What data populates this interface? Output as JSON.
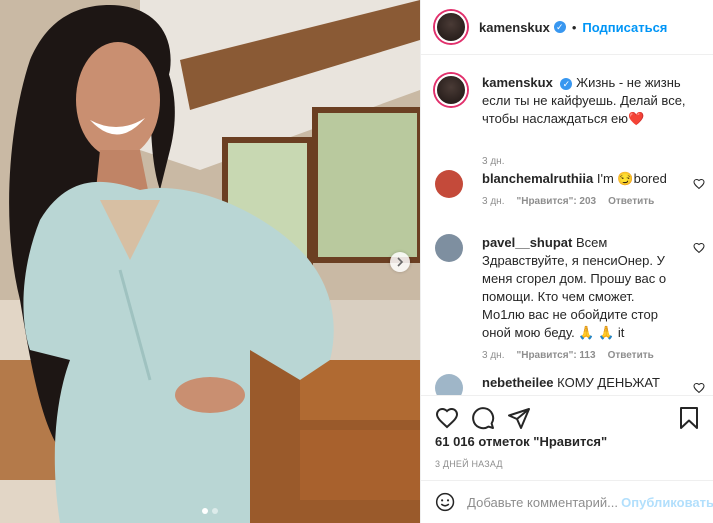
{
  "post": {
    "username": "kamenskux",
    "follow_label": "Подписаться",
    "separator": "•",
    "verified_mark": "✓",
    "caption_user": "kamenskux",
    "caption_text": "Жизнь - не жизнь если ты не кайфуешь. Делай все, чтобы наслаждаться ею",
    "caption_emoji": "❤️",
    "caption_time": "3 дн."
  },
  "comments": [
    {
      "user": "blanchemalruthiia",
      "text": "I'm 😏bored",
      "time": "3 дн.",
      "likes": "\"Нравится\": 203",
      "reply": "Ответить"
    },
    {
      "user": "pavel__shupat",
      "text": "Всем Здравствуйте, я пенсиОнер. У меня сгорел дом. Прошу вас о помощи. Кто чем сможет. Мо1лю вас не обойдите стор оной мою беду. 🙏 🙏 it",
      "time": "3 дн.",
      "likes": "\"Нравится\": 113",
      "reply": "Ответить"
    },
    {
      "user": "nebetheilee",
      "text": "КОМУ ДЕНЬЖАТ"
    }
  ],
  "footer": {
    "likes_text": "61 016 отметок \"Нравится\"",
    "date_text": "3 ДНЕЙ НАЗАД",
    "comment_placeholder": "Добавьте комментарий...",
    "publish_label": "Опубликовать"
  },
  "icons": {
    "like": "heart-icon",
    "comment": "comment-icon",
    "share": "paper-plane-icon",
    "save": "bookmark-icon",
    "emoji": "smiley-icon",
    "next": "chevron-right-icon"
  },
  "colors": {
    "accent": "#0095f6",
    "verified": "#3897f0",
    "muted": "#8e8e8e",
    "publish_disabled": "#b2dffc"
  },
  "carousel": {
    "slides": 2,
    "active_slide": 1
  }
}
